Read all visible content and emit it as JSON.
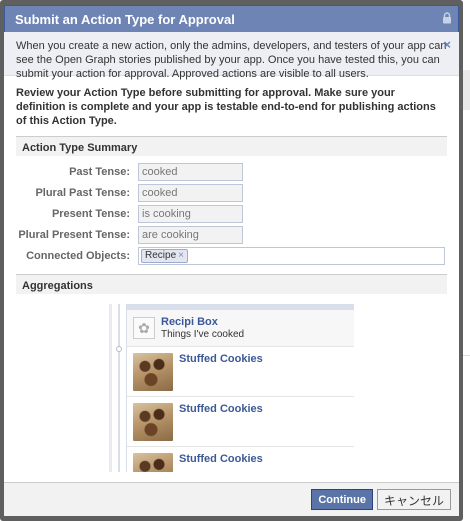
{
  "dialog": {
    "title": "Submit an Action Type for Approval",
    "notice": "When you create a new action, only the admins, developers, and testers of your app can see the Open Graph stories published by your app. Once you have tested this, you can submit your action for approval. Approved actions are visible to all users.",
    "review_text": "Review your Action Type before submitting for approval. Make sure your definition is complete and your app is testable end-to-end for publishing actions of this Action Type."
  },
  "summary": {
    "header": "Action Type Summary",
    "fields": [
      {
        "label": "Past Tense:",
        "value": "cooked"
      },
      {
        "label": "Plural Past Tense:",
        "value": "cooked"
      },
      {
        "label": "Present Tense:",
        "value": "is cooking"
      },
      {
        "label": "Plural Present Tense:",
        "value": "are cooking"
      }
    ],
    "connected_label": "Connected Objects:",
    "connected_token": "Recipe",
    "token_remove": "×"
  },
  "aggregations": {
    "header": "Aggregations",
    "app_name": "Recipi Box",
    "app_subtitle": "Things I've cooked",
    "items": [
      {
        "title": "Stuffed Cookies"
      },
      {
        "title": "Stuffed Cookies"
      },
      {
        "title": "Stuffed Cookies"
      }
    ]
  },
  "footer": {
    "continue_label": "Continue",
    "cancel_label": "キャンセル"
  },
  "icons": {
    "lock": "lock-icon",
    "close": "close-icon",
    "app": "gear-icon"
  }
}
